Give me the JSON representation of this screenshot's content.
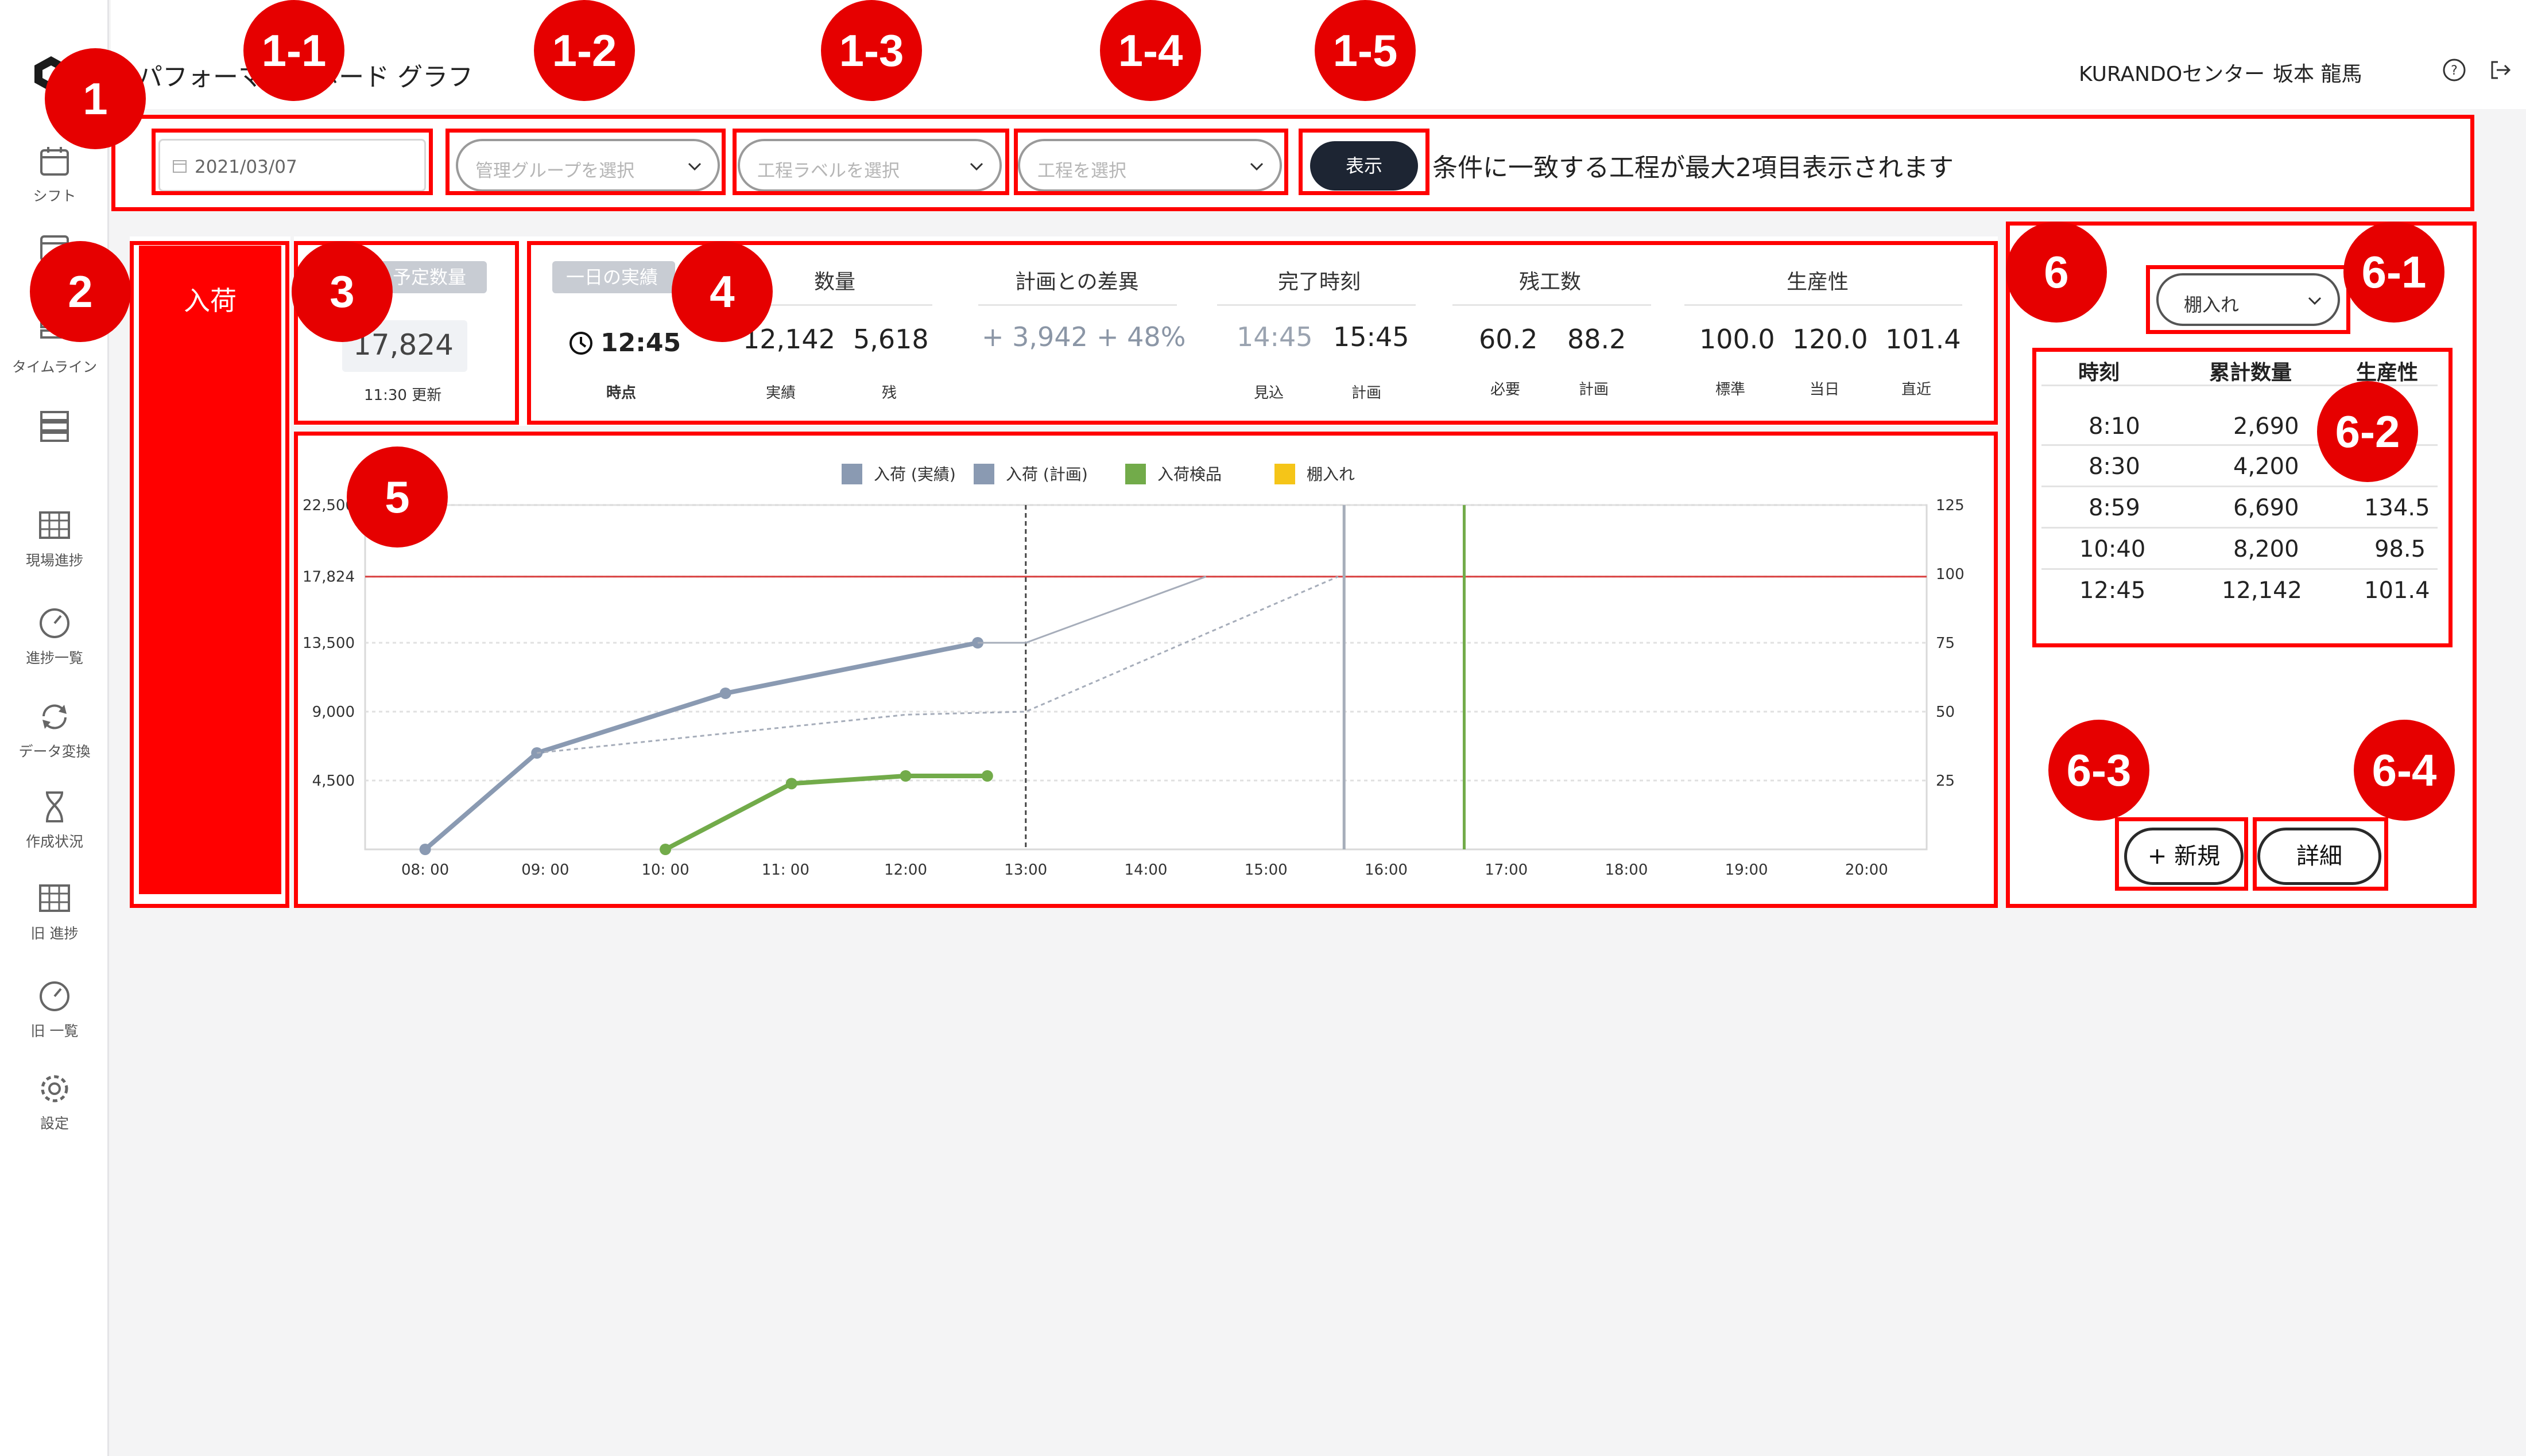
{
  "sidebar": {
    "items": [
      {
        "icon": "calendar-icon",
        "label": "シフト"
      },
      {
        "icon": "calendar-icon",
        "label": "月"
      },
      {
        "icon": "timeline-icon",
        "label": "タイムライン"
      },
      {
        "icon": "rows-icon",
        "label": ""
      },
      {
        "icon": "grid-icon",
        "label": "現場進捗"
      },
      {
        "icon": "gauge-icon",
        "label": "進捗一覧"
      },
      {
        "icon": "refresh-icon",
        "label": "データ変換"
      },
      {
        "icon": "hourglass-icon",
        "label": "作成状況"
      },
      {
        "icon": "grid-icon",
        "label": "旧 進捗"
      },
      {
        "icon": "gauge-icon",
        "label": "旧 一覧"
      },
      {
        "icon": "gear-icon",
        "label": "設定"
      }
    ]
  },
  "header": {
    "title": "パフォーマンスボード グラフ",
    "center": "KURANDOセンター",
    "user": "坂本 龍馬"
  },
  "filters": {
    "date": "2021/03/07",
    "group_placeholder": "管理グループを選択",
    "label_placeholder": "工程ラベルを選択",
    "process_placeholder": "工程を選択",
    "show_button": "表示",
    "hint": "条件に一致する工程が最大2項目表示されます"
  },
  "category": "入荷",
  "planned": {
    "label": "予定数量",
    "value": "17,824",
    "updated": "11:30 更新"
  },
  "summary": {
    "pill": "一日の実績",
    "time": "12:45",
    "time_label": "時点",
    "quantity": {
      "title": "数量",
      "actual": "12,142",
      "actual_label": "実績",
      "remaining": "5,618",
      "remaining_label": "残"
    },
    "diff": {
      "title": "計画との差異",
      "value": "+ 3,942",
      "percent": "+ 48%"
    },
    "finish": {
      "title": "完了時刻",
      "forecast": "14:45",
      "forecast_label": "見込",
      "plan": "15:45",
      "plan_label": "計画"
    },
    "remaining_work": {
      "title": "残工数",
      "required": "60.2",
      "required_label": "必要",
      "plan": "88.2",
      "plan_label": "計画"
    },
    "productivity": {
      "title": "生産性",
      "standard": "100.0",
      "standard_label": "標準",
      "today": "120.0",
      "today_label": "当日",
      "recent": "101.4",
      "recent_label": "直近"
    }
  },
  "chart_data": {
    "type": "line",
    "legend": [
      {
        "name": "入荷 (実績)",
        "color": "#8a9ab2"
      },
      {
        "name": "入荷 (計画)",
        "color": "#8a9ab2"
      },
      {
        "name": "入荷検品",
        "color": "#72ab4a"
      },
      {
        "name": "棚入れ",
        "color": "#f5c518"
      }
    ],
    "x_ticks": [
      "08: 00",
      "09: 00",
      "10: 00",
      "11: 00",
      "12:00",
      "13:00",
      "14:00",
      "15:00",
      "16:00",
      "17:00",
      "18:00",
      "19:00",
      "20:00"
    ],
    "y_left_ticks": [
      "22,500",
      "17,824",
      "13,500",
      "9,000",
      "4,500"
    ],
    "y_right_ticks": [
      "125",
      "100",
      "75",
      "50",
      "25"
    ],
    "xlim": [
      7.5,
      20.5
    ],
    "ylim": [
      0,
      22500
    ],
    "target_line": 17824,
    "series": [
      {
        "name": "入荷 (実績)",
        "style": "solid",
        "color": "#8a9ab2",
        "points": [
          [
            8.0,
            0
          ],
          [
            8.93,
            6300
          ],
          [
            10.5,
            10200
          ],
          [
            12.6,
            13500
          ]
        ]
      },
      {
        "name": "入荷 (実績)",
        "style": "thin",
        "color": "#a6adba",
        "points": [
          [
            12.6,
            13500
          ],
          [
            13.0,
            13500
          ],
          [
            14.5,
            17824
          ]
        ]
      },
      {
        "name": "入荷 (計画)",
        "style": "dashed",
        "color": "#a6adba",
        "points": [
          [
            8.93,
            6300
          ],
          [
            12.0,
            8800
          ],
          [
            13.0,
            9000
          ],
          [
            15.6,
            17824
          ]
        ]
      },
      {
        "name": "入荷検品",
        "style": "solid",
        "color": "#72ab4a",
        "points": [
          [
            10.0,
            0
          ],
          [
            11.05,
            4300
          ],
          [
            12.0,
            4800
          ],
          [
            12.68,
            4800
          ]
        ]
      }
    ],
    "vlines": [
      {
        "x": 13.0,
        "style": "dashed",
        "color": "#444444"
      },
      {
        "x": 15.65,
        "style": "solid",
        "color": "#a6adba"
      },
      {
        "x": 16.65,
        "style": "solid",
        "color": "#72ab4a"
      }
    ]
  },
  "side": {
    "select": "棚入れ",
    "columns": [
      "時刻",
      "累計数量",
      "生産性"
    ],
    "rows": [
      [
        "8:10",
        "2,690",
        ""
      ],
      [
        "8:30",
        "4,200",
        ""
      ],
      [
        "8:59",
        "6,690",
        "134.5"
      ],
      [
        "10:40",
        "8,200",
        "98.5"
      ],
      [
        "12:45",
        "12,142",
        "101.4"
      ]
    ],
    "new_button": "+ 新規",
    "detail_button": "詳細"
  },
  "annotations": [
    "1",
    "1-1",
    "1-2",
    "1-3",
    "1-4",
    "1-5",
    "2",
    "3",
    "4",
    "5",
    "6",
    "6-1",
    "6-2",
    "6-3",
    "6-4"
  ]
}
